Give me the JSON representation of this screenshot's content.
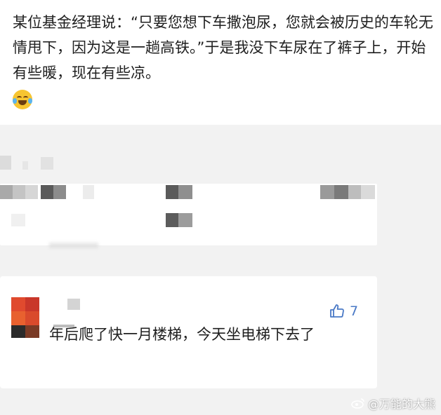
{
  "post": {
    "text": "某位基金经理说：“只要您想下车撒泡尿，您就会被历史的车轮无情甩下，因为这是一趟高铁。”于是我没下车尿在了裤子上，开始有些暖，现在有些凉。",
    "emoji": "laughing-with-tears-emoji"
  },
  "comment": {
    "text": "年后爬了快一月楼梯，今天坐电梯下去了",
    "like_count": "7",
    "like_icon": "thumbs-up-icon"
  },
  "watermark": {
    "text": "@万能的大熊",
    "logo_icon": "weibo-logo-icon"
  },
  "colors": {
    "background": "#f2f2f2",
    "card": "#ffffff",
    "like_accent": "#4a79c6",
    "avatar_red": "#e04a2e"
  }
}
